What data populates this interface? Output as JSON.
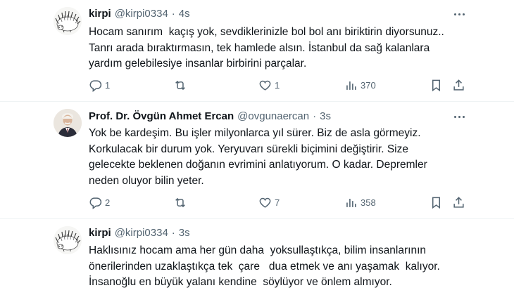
{
  "tweets": [
    {
      "name": "kirpi",
      "handle": "@kirpi0334",
      "dot": "·",
      "time": "4s",
      "lines": [
        "Hocam sanırım  kaçış yok, sevdiklerinizle bol bol anı biriktirin diyorsunuz..",
        "Tanrı arada bıraktırmasın, tek hamlede alsın. İstanbul da sağ kalanlara",
        "yardım gelebilesiye insanlar birbirini parçalar."
      ],
      "replies": "1",
      "retweets": "",
      "likes": "1",
      "views": "370",
      "avatar_icon": "hedgehog-sketch"
    },
    {
      "name": "Prof. Dr. Övgün Ahmet Ercan",
      "handle": "@ovgunaercan",
      "dot": "·",
      "time": "3s",
      "lines": [
        "Yok be kardeşim. Bu işler milyonlarca yıl sürer. Biz de asla görmeyiz.",
        "Korkulacak bir durum yok. Yeryuvarı sürekli biçimini değiştirir. Size",
        "gelecekte beklenen doğanın evrimini anlatıyorum. O kadar. Depremler",
        "neden oluyor bilin yeter."
      ],
      "replies": "2",
      "retweets": "",
      "likes": "7",
      "views": "358",
      "avatar_icon": "person-portrait"
    },
    {
      "name": "kirpi",
      "handle": "@kirpi0334",
      "dot": "·",
      "time": "3s",
      "lines": [
        "Haklısınız hocam ama her gün daha  yoksullaştıkça, bilim insanlarının",
        "önerilerinden uzaklaştıkça tek  çare   dua etmek ve anı yaşamak  kalıyor.",
        "İnsanoğlu en büyük yalanı kendine  söylüyor ve önlem almıyor."
      ],
      "avatar_icon": "hedgehog-sketch"
    }
  ],
  "colors": {
    "text": "#0f1419",
    "secondary": "#536471",
    "divider": "#eff3f4"
  }
}
